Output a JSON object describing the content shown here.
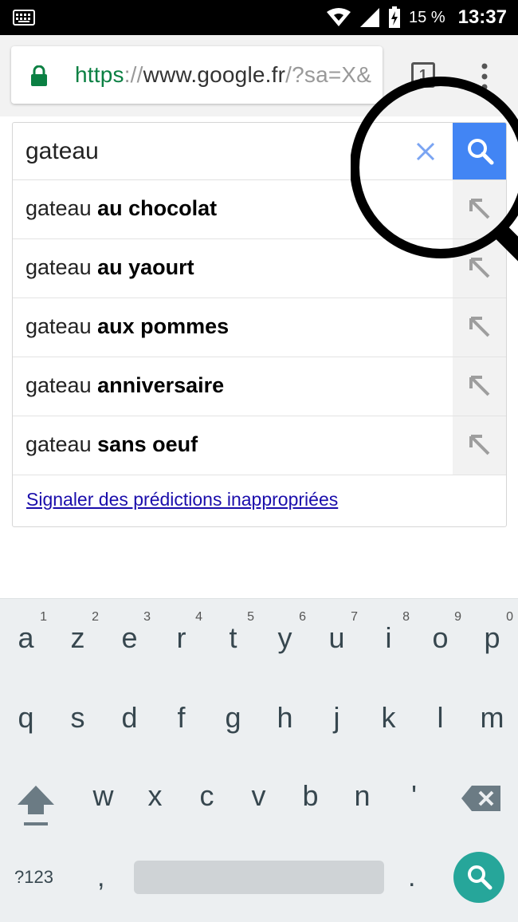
{
  "status_bar": {
    "battery_percent": "15 %",
    "time": "13:37",
    "icons": [
      "keyboard-icon",
      "wifi-icon",
      "signal-icon",
      "battery-charging-icon"
    ]
  },
  "toolbar": {
    "url_scheme": "https",
    "url_separator": "://",
    "url_host": "www.google.fr",
    "url_path": "/?sa=X&",
    "tab_count": "1",
    "icons": [
      "lock-icon",
      "more-vert-icon"
    ]
  },
  "search": {
    "query": "gateau",
    "icons": [
      "clear-icon",
      "search-icon"
    ]
  },
  "suggestions": [
    {
      "prefix": "gateau ",
      "completion": "au chocolat"
    },
    {
      "prefix": "gateau ",
      "completion": "au yaourt"
    },
    {
      "prefix": "gateau ",
      "completion": "aux pommes"
    },
    {
      "prefix": "gateau ",
      "completion": "anniversaire"
    },
    {
      "prefix": "gateau ",
      "completion": "sans oeuf"
    }
  ],
  "report_link": "Signaler des prédictions inappropriées",
  "keyboard": {
    "row1": [
      {
        "key": "a",
        "hint": "1"
      },
      {
        "key": "z",
        "hint": "2"
      },
      {
        "key": "e",
        "hint": "3"
      },
      {
        "key": "r",
        "hint": "4"
      },
      {
        "key": "t",
        "hint": "5"
      },
      {
        "key": "y",
        "hint": "6"
      },
      {
        "key": "u",
        "hint": "7"
      },
      {
        "key": "i",
        "hint": "8"
      },
      {
        "key": "o",
        "hint": "9"
      },
      {
        "key": "p",
        "hint": "0"
      }
    ],
    "row2": [
      "q",
      "s",
      "d",
      "f",
      "g",
      "h",
      "j",
      "k",
      "l",
      "m"
    ],
    "row3": [
      "w",
      "x",
      "c",
      "v",
      "b",
      "n",
      "'"
    ],
    "symbols": "?123",
    "comma": ",",
    "period": ".",
    "icons": [
      "shift-icon",
      "backspace-icon",
      "search-icon"
    ]
  },
  "colors": {
    "search_blue": "#4285f4",
    "secure_green": "#0b8043",
    "link": "#1a0dab",
    "keyboard_action": "#26a69a"
  }
}
